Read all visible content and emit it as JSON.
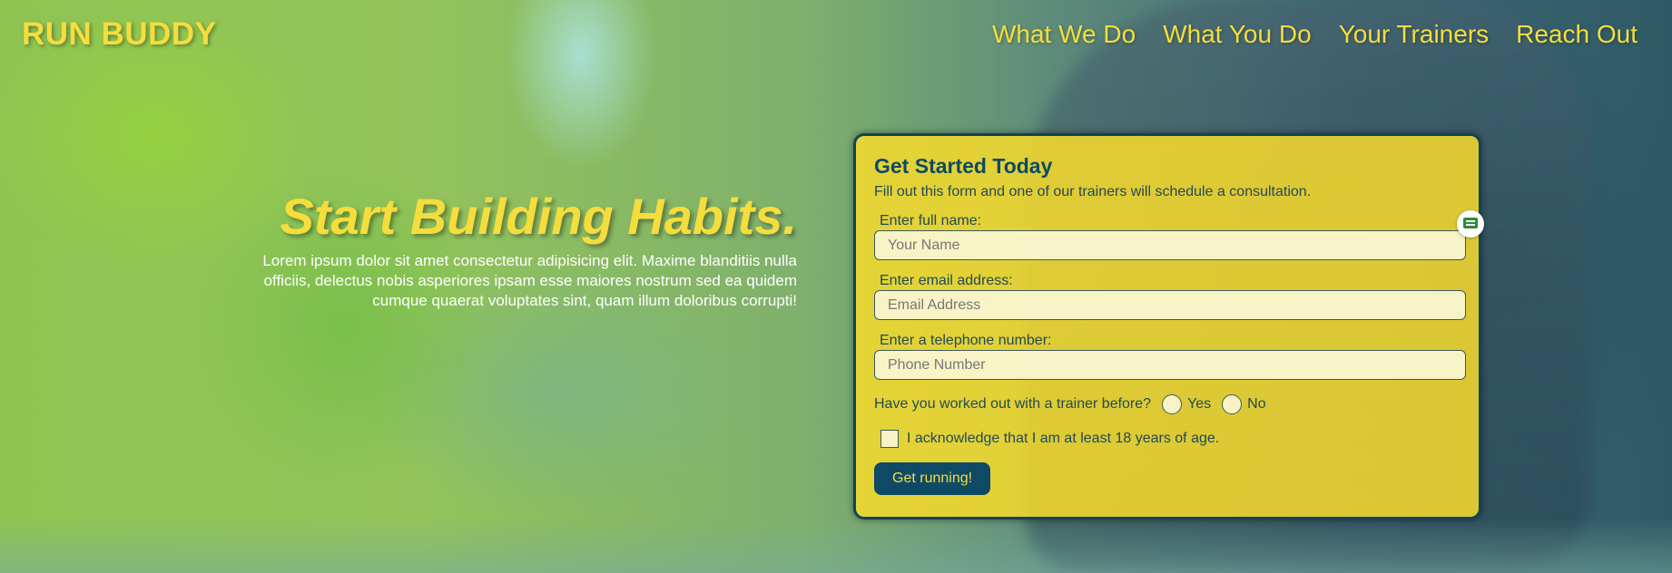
{
  "brand": {
    "name": "RUN BUDDY"
  },
  "nav": {
    "items": [
      "What We Do",
      "What You Do",
      "Your Trainers",
      "Reach Out"
    ]
  },
  "hero": {
    "title": "Start Building Habits.",
    "body": "Lorem ipsum dolor sit amet consectetur adipisicing elit. Maxime blanditiis nulla officiis, delectus nobis asperiores ipsam esse maiores nostrum sed ea quidem cumque quaerat voluptates sint, quam illum doloribus corrupti!"
  },
  "form": {
    "title": "Get Started Today",
    "subtitle": "Fill out this form and one of our trainers will schedule a consultation.",
    "name_label": "Enter full name:",
    "name_placeholder": "Your Name",
    "email_label": "Enter email address:",
    "email_placeholder": "Email Address",
    "phone_label": "Enter a telephone number:",
    "phone_placeholder": "Phone Number",
    "trainer_question": "Have you worked out with a trainer before?",
    "yes_label": "Yes",
    "no_label": "No",
    "age_ack": "I acknowledge that I am at least 18 years of age.",
    "submit_label": "Get running!"
  },
  "colors": {
    "accent_yellow": "#f5dd3d",
    "navy": "#0e4a66",
    "form_bg": "#f7db2c"
  },
  "icons": {
    "widget": "form-helper-icon"
  }
}
